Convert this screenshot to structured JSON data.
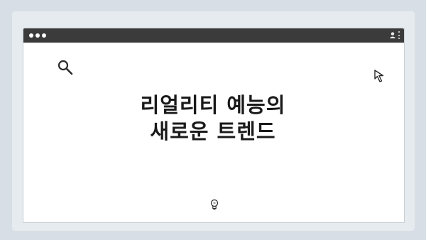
{
  "slide": {
    "title_line1": "리얼리티 예능의",
    "title_line2": "새로운 트렌드"
  },
  "colors": {
    "background": "#d8dee5",
    "panel": "#e6ebef",
    "titlebar": "#3b3b3b",
    "window": "#ffffff",
    "text": "#1a1a1a"
  },
  "icons": [
    "search-icon",
    "cursor-icon",
    "lightbulb-icon",
    "user-icon",
    "kebab-menu-icon"
  ]
}
